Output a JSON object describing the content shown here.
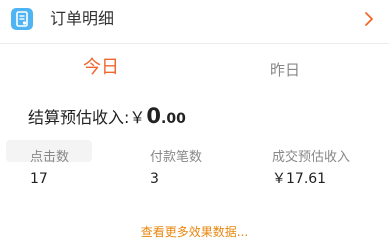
{
  "order_detail": {
    "title": "订单明细"
  },
  "tabs": [
    {
      "label": "今日",
      "selected": true
    },
    {
      "label": "昨日",
      "selected": false
    }
  ],
  "settlement": {
    "label": "结算预估收入:",
    "currency": "￥",
    "amount_integer": "0",
    "amount_decimal": ".00"
  },
  "stats": [
    {
      "label": "点击数",
      "value": "17"
    },
    {
      "label": "付款笔数",
      "value": "3"
    },
    {
      "label": "成交预估收入",
      "value": "￥17.61"
    }
  ],
  "more_link": "查看更多效果数据...",
  "colors": {
    "accent": "#f2662c",
    "link": "#e8870f",
    "icon_bg": "#4eb4f4"
  },
  "icons": {
    "order": "document-icon",
    "arrow": "chevron-right-icon"
  }
}
